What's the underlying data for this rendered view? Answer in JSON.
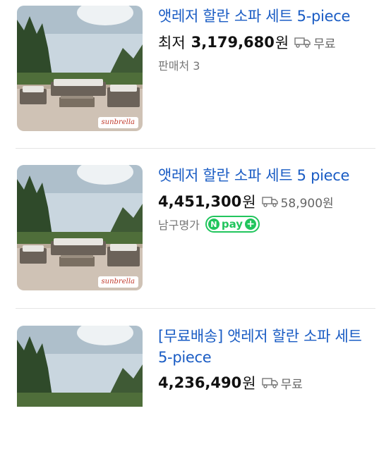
{
  "products": [
    {
      "title": "앳레저 할란 소파 세트 5-piece",
      "price_prefix": "최저",
      "price": "3,179,680",
      "won": "원",
      "shipping": "무료",
      "meta": "판매처 3",
      "brand_badge": "sunbrella",
      "npay": false
    },
    {
      "title": "앳레저 할란 소파 세트 5 piece",
      "price_prefix": "",
      "price": "4,451,300",
      "won": "원",
      "shipping": "58,900원",
      "meta": "남구명가",
      "brand_badge": "sunbrella",
      "npay": true,
      "npay_label": "pay"
    },
    {
      "title": "[무료배송] 앳레저 할란 소파 세트 5-piece",
      "price_prefix": "",
      "price": "4,236,490",
      "won": "원",
      "shipping": "무료"
    }
  ],
  "colors": {
    "title": "#1a5cc4",
    "npay_green": "#21c55d"
  }
}
